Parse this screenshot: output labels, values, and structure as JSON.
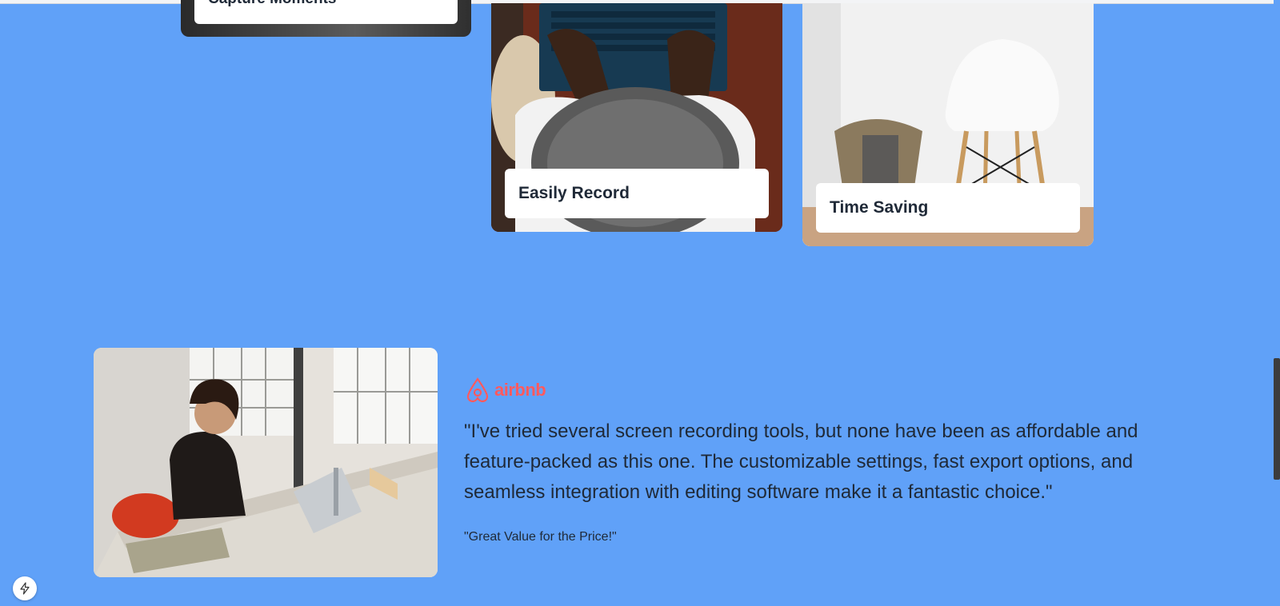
{
  "features": {
    "cards": [
      {
        "label": "Capture Moments"
      },
      {
        "label": "Easily Record"
      },
      {
        "label": "Time Saving"
      }
    ]
  },
  "testimonial": {
    "brand": "airbnb",
    "brand_color": "#ff5a5f",
    "quote": "\"I've tried several screen recording tools, but none have been as affordable and feature-packed as this one. The customizable settings, fast export options, and seamless integration with editing software make it a fantastic choice.\"",
    "title": "\"Great Value for the Price!\""
  },
  "colors": {
    "background": "#60a1f8",
    "card_label_text": "#1f2937"
  },
  "icons": {
    "floating_button": "lightning-icon",
    "brand_logo": "airbnb-logo-icon"
  }
}
